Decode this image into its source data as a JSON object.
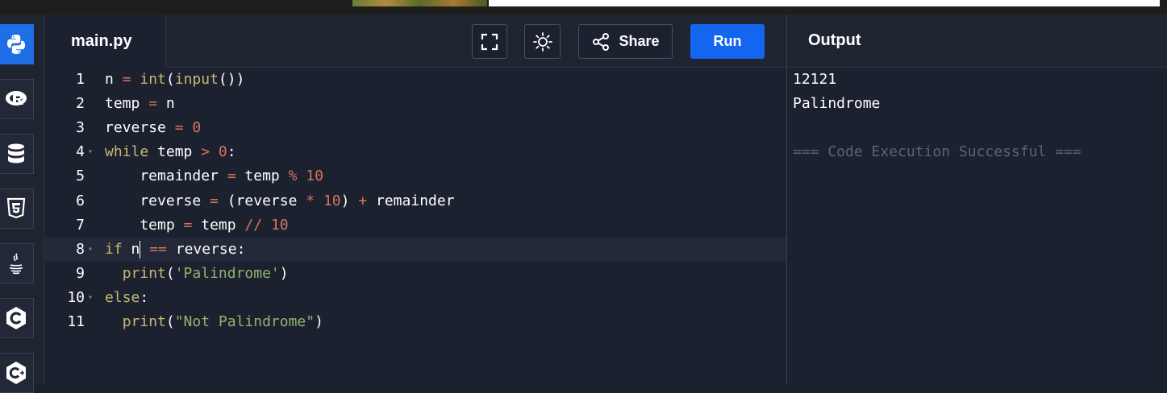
{
  "sidebar": {
    "languages": [
      {
        "name": "Python",
        "icon": "python-icon",
        "active": true
      },
      {
        "name": "R",
        "icon": "r-icon",
        "active": false
      },
      {
        "name": "SQL",
        "icon": "database-icon",
        "active": false
      },
      {
        "name": "HTML",
        "icon": "html5-icon",
        "active": false
      },
      {
        "name": "Java",
        "icon": "java-icon",
        "active": false
      },
      {
        "name": "C",
        "icon": "c-icon",
        "active": false
      },
      {
        "name": "C++",
        "icon": "cpp-icon",
        "active": false
      }
    ]
  },
  "editor": {
    "filename": "main.py",
    "toolbar": {
      "fullscreen_icon": "fullscreen-icon",
      "theme_icon": "sun-icon",
      "share_icon": "share-icon",
      "share_label": "Share",
      "run_label": "Run"
    },
    "lines": [
      {
        "n": "1",
        "fold": false,
        "tokens": [
          [
            "",
            "n "
          ],
          [
            "op",
            "="
          ],
          [
            "",
            " "
          ],
          [
            "kw",
            "int"
          ],
          [
            "",
            "("
          ],
          [
            "kw",
            "input"
          ],
          [
            "",
            "())"
          ]
        ]
      },
      {
        "n": "2",
        "fold": false,
        "tokens": [
          [
            "",
            "temp "
          ],
          [
            "op",
            "="
          ],
          [
            "",
            " n"
          ]
        ]
      },
      {
        "n": "3",
        "fold": false,
        "tokens": [
          [
            "",
            "reverse "
          ],
          [
            "op",
            "="
          ],
          [
            "",
            " "
          ],
          [
            "num",
            "0"
          ]
        ]
      },
      {
        "n": "4",
        "fold": true,
        "tokens": [
          [
            "kw",
            "while"
          ],
          [
            "",
            " temp "
          ],
          [
            "op",
            ">"
          ],
          [
            "",
            " "
          ],
          [
            "num",
            "0"
          ],
          [
            "",
            ":"
          ]
        ]
      },
      {
        "n": "5",
        "fold": false,
        "tokens": [
          [
            "",
            "    remainder "
          ],
          [
            "op",
            "="
          ],
          [
            "",
            " temp "
          ],
          [
            "op",
            "%"
          ],
          [
            "",
            " "
          ],
          [
            "num",
            "10"
          ]
        ]
      },
      {
        "n": "6",
        "fold": false,
        "tokens": [
          [
            "",
            "    reverse "
          ],
          [
            "op",
            "="
          ],
          [
            "",
            " (reverse "
          ],
          [
            "op",
            "*"
          ],
          [
            "",
            " "
          ],
          [
            "num",
            "10"
          ],
          [
            "",
            ") "
          ],
          [
            "op",
            "+"
          ],
          [
            "",
            " remainder"
          ]
        ]
      },
      {
        "n": "7",
        "fold": false,
        "tokens": [
          [
            "",
            "    temp "
          ],
          [
            "op",
            "="
          ],
          [
            "",
            " temp "
          ],
          [
            "op",
            "//"
          ],
          [
            "",
            " "
          ],
          [
            "num",
            "10"
          ]
        ]
      },
      {
        "n": "8",
        "fold": true,
        "active": true,
        "tokens": [
          [
            "kw",
            "if"
          ],
          [
            "",
            " n"
          ],
          [
            "cursor",
            ""
          ],
          [
            "",
            " "
          ],
          [
            "op",
            "=="
          ],
          [
            "",
            " reverse:"
          ]
        ]
      },
      {
        "n": "9",
        "fold": false,
        "tokens": [
          [
            "",
            "  "
          ],
          [
            "kw",
            "print"
          ],
          [
            "",
            "("
          ],
          [
            "str",
            "'Palindrome'"
          ],
          [
            "",
            ")"
          ]
        ]
      },
      {
        "n": "10",
        "fold": true,
        "tokens": [
          [
            "kw",
            "else"
          ],
          [
            "",
            ":"
          ]
        ]
      },
      {
        "n": "11",
        "fold": false,
        "tokens": [
          [
            "",
            "  "
          ],
          [
            "kw",
            "print"
          ],
          [
            "",
            "("
          ],
          [
            "str",
            "\"Not Palindrome\""
          ],
          [
            "",
            ")"
          ]
        ]
      }
    ]
  },
  "output": {
    "title": "Output",
    "lines": [
      "12121",
      "Palindrome",
      "",
      "=== Code Execution Successful ==="
    ]
  },
  "colors": {
    "accent": "#1466f0",
    "background": "#1c2130",
    "keyword": "#c9b870",
    "operator": "#d7745a",
    "string": "#8fb46a",
    "muted": "#5d6373"
  }
}
